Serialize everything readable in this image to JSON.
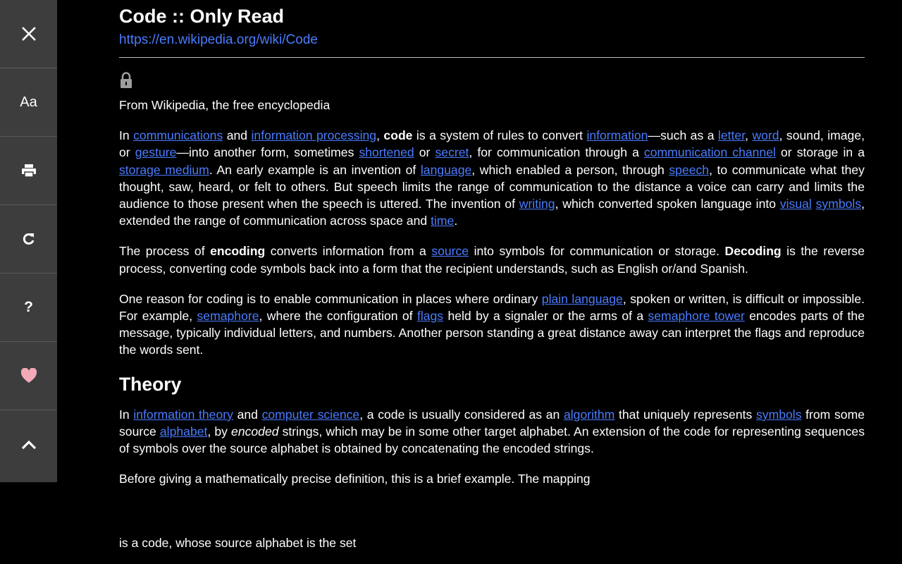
{
  "sidebar": {
    "close_icon": "close-icon",
    "font_label": "Aa",
    "print_icon": "print-icon",
    "refresh_icon": "refresh-icon",
    "help_label": "?",
    "like_icon": "heart-icon",
    "scroll_top_icon": "chevron-up-icon"
  },
  "colors": {
    "background": "#000000",
    "sidebar": "#3d3d3d",
    "link": "#4a7cff",
    "heart": "#f4a9b8"
  },
  "article": {
    "title": "Code :: Only Read",
    "url": "https://en.wikipedia.org/wiki/Code",
    "tagline": "From Wikipedia, the free encyclopedia",
    "p1": {
      "t1": "In ",
      "l_communications": "communications",
      "t2": " and ",
      "l_information_processing": "information processing",
      "t3": ", ",
      "b_code": "code",
      "t4": " is a system of rules to convert ",
      "l_information": "information",
      "t5": "—such as a ",
      "l_letter": "letter",
      "t6": ", ",
      "l_word": "word",
      "t7": ", sound, image, or ",
      "l_gesture": "gesture",
      "t8": "—into another form, sometimes ",
      "l_shortened": "shortened",
      "t9": " or ",
      "l_secret": "secret",
      "t10": ", for communication through a ",
      "l_communication_channel": "communication channel",
      "t11": " or storage in a ",
      "l_storage_medium": "storage medium",
      "t12": ". An early example is an invention of ",
      "l_language": "language",
      "t13": ", which enabled a person, through ",
      "l_speech": "speech",
      "t14": ", to communicate what they thought, saw, heard, or felt to others. But speech limits the range of communication to the distance a voice can carry and limits the audience to those present when the speech is uttered. The invention of ",
      "l_writing": "writing",
      "t15": ", which converted spoken language into ",
      "l_visual": "visual",
      "t16": " ",
      "l_symbols": "symbols",
      "t17": ", extended the range of communication across space and ",
      "l_time": "time",
      "t18": "."
    },
    "p2": {
      "t1": "The process of ",
      "b_encoding": "encoding",
      "t2": " converts information from a ",
      "l_source": "source",
      "t3": " into symbols for communication or storage. ",
      "b_decoding": "Decoding",
      "t4": " is the reverse process, converting code symbols back into a form that the recipient understands, such as English or/and Spanish."
    },
    "p3": {
      "t1": "One reason for coding is to enable communication in places where ordinary ",
      "l_plain_language": "plain language",
      "t2": ", spoken or written, is difficult or impossible. For example, ",
      "l_semaphore": "semaphore",
      "t3": ", where the configuration of ",
      "l_flags": "flags",
      "t4": " held by a signaler or the arms of a ",
      "l_semaphore_tower": "semaphore tower",
      "t5": " encodes parts of the message, typically individual letters, and numbers. Another person standing a great distance away can interpret the flags and reproduce the words sent."
    },
    "section_theory": "Theory",
    "p4": {
      "t1": "In ",
      "l_information_theory": "information theory",
      "t2": " and ",
      "l_computer_science": "computer science",
      "t3": ", a code is usually considered as an ",
      "l_algorithm": "algorithm",
      "t4": " that uniquely represents ",
      "l_symbols": "symbols",
      "t5": " from some source ",
      "l_alphabet": "alphabet",
      "t6": ", by ",
      "i_encoded": "encoded",
      "t7": " strings, which may be in some other target alphabet. An extension of the code for representing sequences of symbols over the source alphabet is obtained by concatenating the encoded strings."
    },
    "p5": "Before giving a mathematically precise definition, this is a brief example. The mapping",
    "p6": "is a code, whose source alphabet is the set"
  }
}
